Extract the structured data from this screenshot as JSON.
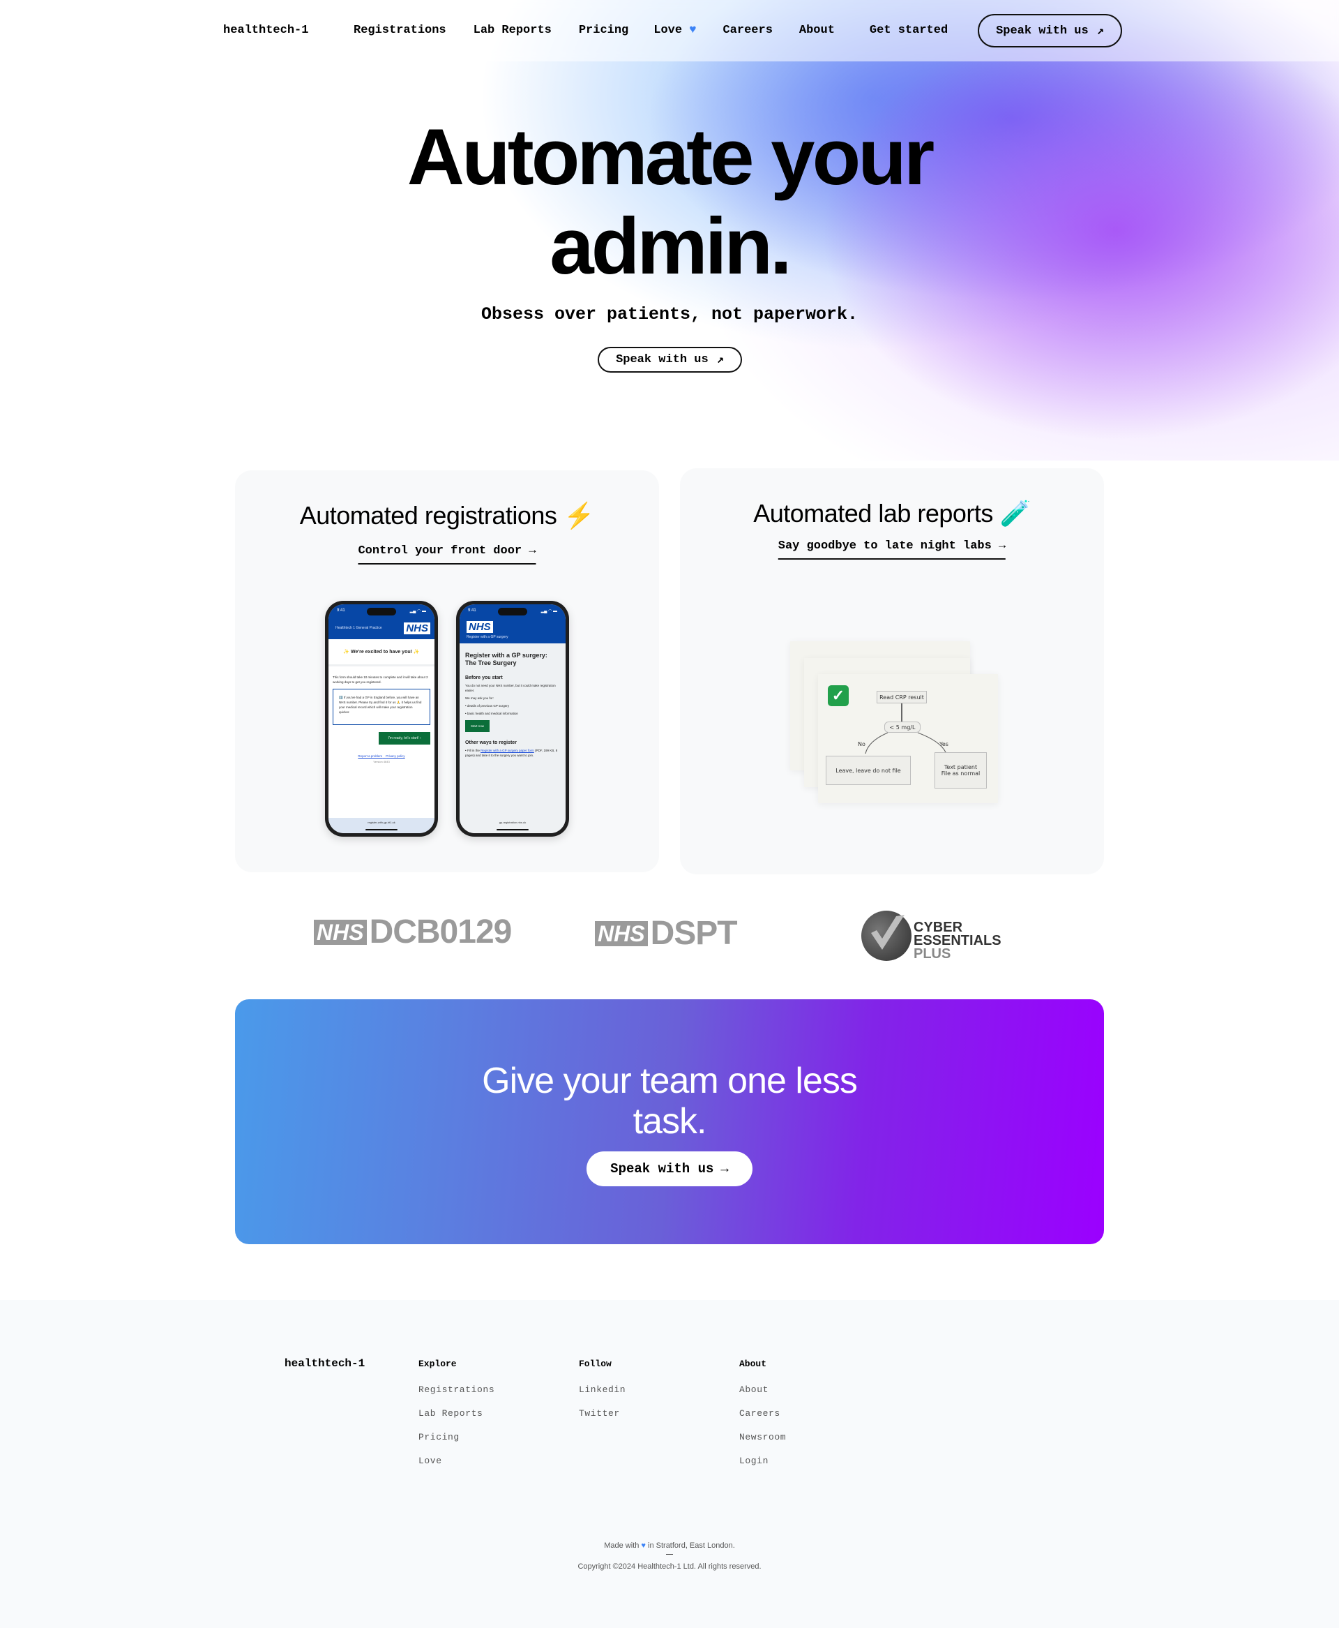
{
  "nav": {
    "brand": "healthtech-1",
    "links": [
      "Registrations",
      "Lab Reports",
      "Pricing",
      "Love",
      "Careers",
      "About",
      "Get started"
    ],
    "love_icon": "blue-heart-icon",
    "cta_label": "Speak with us",
    "cta_icon": "arrow-up-right-icon"
  },
  "hero": {
    "title_line1": "Automate your",
    "title_line2": "admin.",
    "subtitle": "Obsess over patients, not paperwork.",
    "cta_label": "Speak with us",
    "cta_icon": "arrow-up-right-icon"
  },
  "cards": {
    "registrations": {
      "title": "Automated registrations",
      "title_icon": "lightning-icon",
      "link": "Control your front door",
      "link_icon": "arrow-right-icon",
      "phone1": {
        "time": "9:41",
        "practice": "Healthtech 1 General Practice",
        "nhs": "NHS",
        "welcome": "✨ We're excited to have you! ✨",
        "intro": "This form should take 10 minutes to complete and it will take about 2 working days to get you registered.",
        "info": "ℹ️ If you've had a GP in England before, you will have an NHS number. Please try and find it for us 🙏 it helps us find your medical record which will make your registration quicker.",
        "button": "I'm ready, let's start! ›",
        "link_report": "Report a problem",
        "link_privacy": "Privacy policy",
        "version": "Version 4643",
        "url": "register-with-gp.ht1.uk"
      },
      "phone2": {
        "time": "9:41",
        "nhs": "NHS",
        "header_sub": "Register with a GP surgery",
        "title": "Register with a GP surgery: The Tree Surgery",
        "before_heading": "Before you start",
        "before_text": "You do not need your NHS number, but it could make registration easier.",
        "ask_text": "We may ask you for:",
        "bullets": [
          "details of previous GP surgery",
          "basic health and medical information"
        ],
        "button": "Start now",
        "other_heading": "Other ways to register",
        "other_prefix": "Fill in the ",
        "other_link": "Register with a GP surgery paper form",
        "other_suffix": " (PDF, 199 KB, 8 pages) and take it to the surgery you want to join.",
        "url": "gp-registration.nhs.uk"
      }
    },
    "lab_reports": {
      "title": "Automated lab reports",
      "title_icon": "test-tube-icon",
      "link": "Say goodbye to late night labs",
      "link_icon": "arrow-right-icon",
      "flow": {
        "start": "Read CRP result",
        "decision": "< 5 mg/L",
        "no_label": "No",
        "yes_label": "Yes",
        "no_action": "Leave, leave do not file",
        "yes_action_1": "Text patient",
        "yes_action_2": "File as normal"
      }
    }
  },
  "certifications": [
    {
      "badge": "NHS",
      "name": "DCB0129"
    },
    {
      "badge": "NHS",
      "name": "DSPT"
    },
    {
      "line1": "CYBER",
      "line2": "ESSENTIALS",
      "line3": "PLUS"
    }
  ],
  "banner": {
    "title_line1": "Give your team one less",
    "title_line2": "task.",
    "cta_label": "Speak with us",
    "cta_icon": "arrow-right-icon",
    "colors": {
      "start": "#4a9aea",
      "end": "#9b00ff"
    }
  },
  "footer": {
    "brand": "healthtech-1",
    "columns": [
      {
        "heading": "Explore",
        "links": [
          "Registrations",
          "Lab Reports",
          "Pricing",
          "Love"
        ]
      },
      {
        "heading": "Follow",
        "links": [
          "Linkedin",
          "Twitter"
        ]
      },
      {
        "heading": "About",
        "links": [
          "About",
          "Careers",
          "Newsroom",
          "Login"
        ]
      }
    ],
    "made_prefix": "Made with",
    "made_suffix": "in Stratford, East London.",
    "copyright": "Copyright ©2024 Healthtech-1 Ltd. All rights reserved."
  }
}
